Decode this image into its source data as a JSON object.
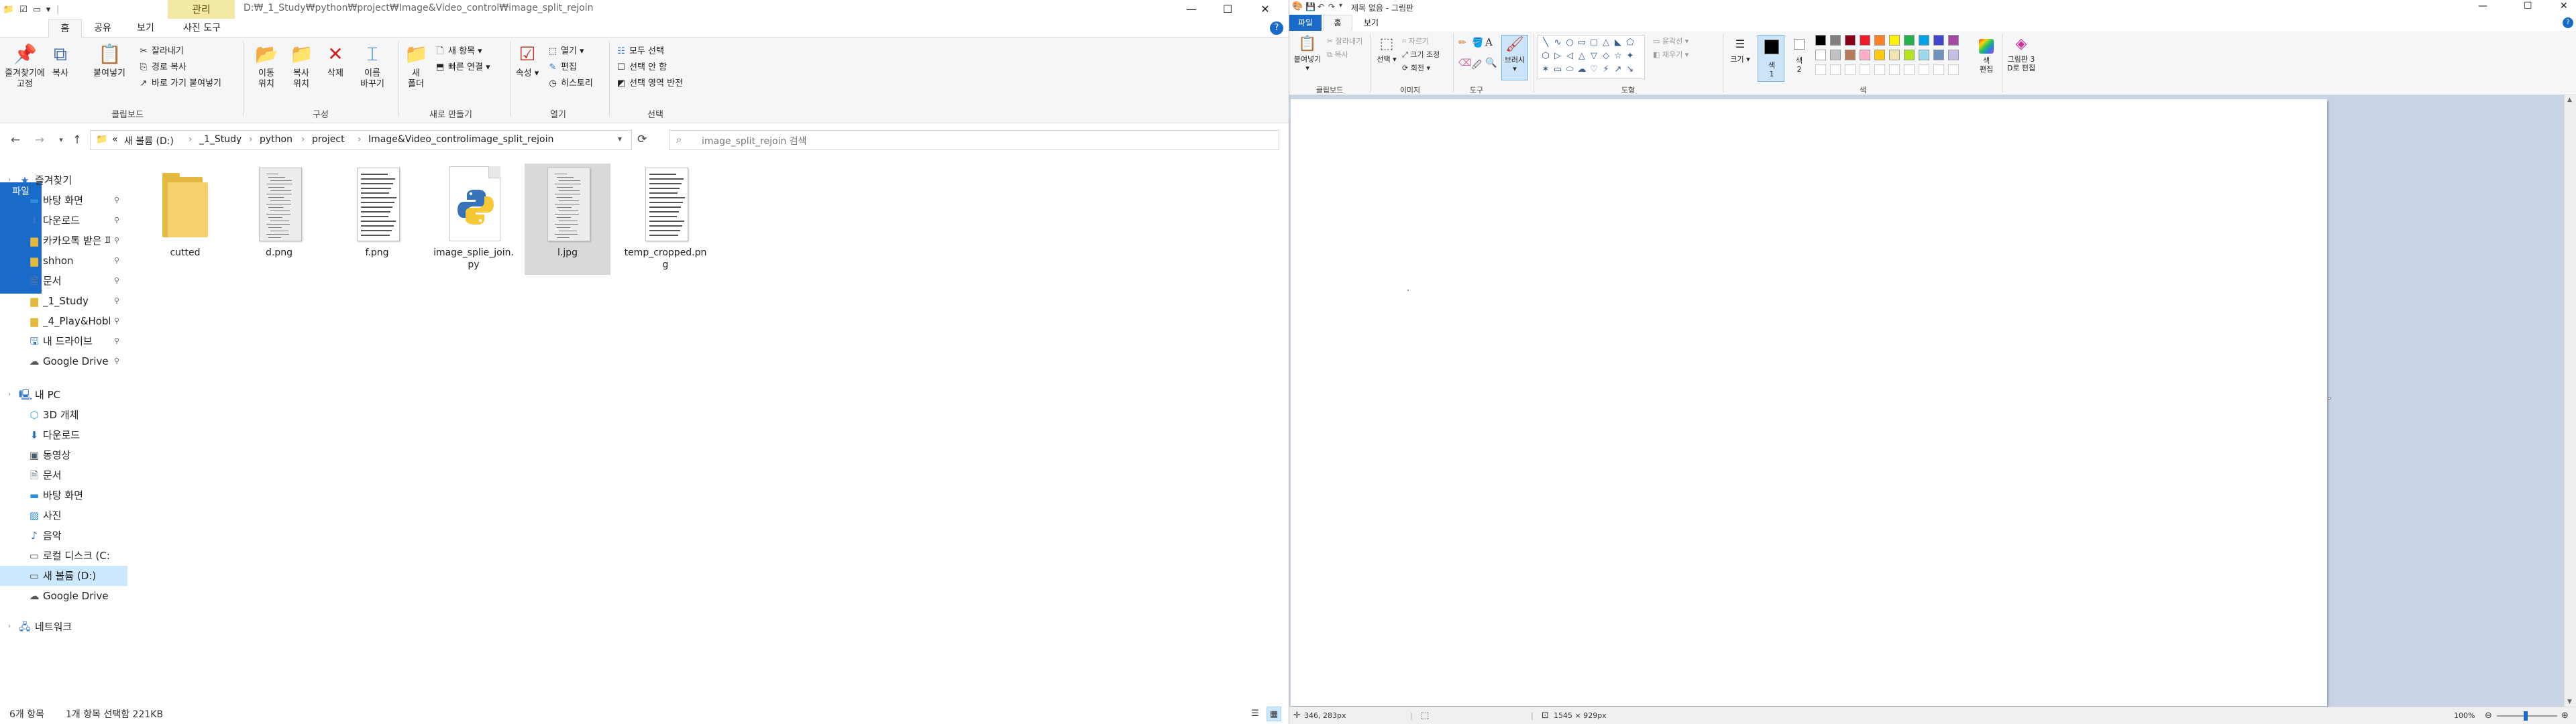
{
  "explorer": {
    "manage_tab": "관리",
    "title_path": "D:₩_1_Study₩python₩project₩Image&Video_control₩image_split_rejoin",
    "tabs": [
      "파일",
      "홈",
      "공유",
      "보기",
      "사진 도구"
    ],
    "window_buttons": [
      "—",
      "☐",
      "✕"
    ],
    "help": "?",
    "ribbon": {
      "pin_quick": "즐겨찾기에\n고정",
      "copy": "복사",
      "paste": "붙여넣기",
      "cut": "잘라내기",
      "copy_path": "경로 복사",
      "paste_shortcut": "바로 가기 붙여넣기",
      "move_to": "이동\n위치",
      "copy_to": "복사\n위치",
      "delete": "삭제",
      "rename": "이름\n바꾸기",
      "new_folder": "새\n폴더",
      "new_item": "새 항목",
      "easy_access": "빠른 연결",
      "properties": "속성",
      "open": "열기",
      "edit": "편집",
      "history": "히스토리",
      "select_all": "모두 선택",
      "select_none": "선택 안 함",
      "invert_selection": "선택 영역 반전",
      "groups": [
        "클립보드",
        "구성",
        "새로 만들기",
        "열기",
        "선택"
      ]
    },
    "address": {
      "crumbs": [
        "새 볼륨 (D:)",
        "_1_Study",
        "python",
        "project",
        "Image&Video_control",
        "image_split_rejoin"
      ],
      "prefix": "«"
    },
    "search_placeholder": "image_split_rejoin 검색",
    "nav": [
      {
        "label": "즐겨찾기",
        "icon": "star-icon",
        "pinned": false,
        "level": 0
      },
      {
        "label": "바탕 화면",
        "icon": "desktop-icon",
        "pinned": true,
        "level": 1
      },
      {
        "label": "다운로드",
        "icon": "download-icon",
        "pinned": true,
        "level": 1
      },
      {
        "label": "카카오톡 받은 파",
        "icon": "folder-icon",
        "pinned": true,
        "level": 1
      },
      {
        "label": "shhon",
        "icon": "folder-icon",
        "pinned": true,
        "level": 1
      },
      {
        "label": "문서",
        "icon": "document-icon",
        "pinned": true,
        "level": 1
      },
      {
        "label": "_1_Study",
        "icon": "folder-icon",
        "pinned": true,
        "level": 1
      },
      {
        "label": "_4_Play&Hobby",
        "icon": "folder-icon",
        "pinned": true,
        "level": 1
      },
      {
        "label": "내 드라이브",
        "icon": "drive-icon",
        "pinned": true,
        "level": 1
      },
      {
        "label": "Google Drive (G",
        "icon": "cloud-drive-icon",
        "pinned": true,
        "level": 1
      },
      {
        "label": "내 PC",
        "icon": "pc-icon",
        "pinned": false,
        "level": 0
      },
      {
        "label": "3D 개체",
        "icon": "3d-objects-icon",
        "pinned": false,
        "level": 1
      },
      {
        "label": "다운로드",
        "icon": "download-icon",
        "pinned": false,
        "level": 1
      },
      {
        "label": "동영상",
        "icon": "video-icon",
        "pinned": false,
        "level": 1
      },
      {
        "label": "문서",
        "icon": "document-icon",
        "pinned": false,
        "level": 1
      },
      {
        "label": "바탕 화면",
        "icon": "desktop-icon",
        "pinned": false,
        "level": 1
      },
      {
        "label": "사진",
        "icon": "pictures-icon",
        "pinned": false,
        "level": 1
      },
      {
        "label": "음악",
        "icon": "music-icon",
        "pinned": false,
        "level": 1
      },
      {
        "label": "로컬 디스크 (C:)",
        "icon": "disk-icon",
        "pinned": false,
        "level": 1
      },
      {
        "label": "새 볼륨 (D:)",
        "icon": "disk-icon",
        "pinned": false,
        "level": 1,
        "active": true
      },
      {
        "label": "Google Drive (G:)",
        "icon": "cloud-drive-icon",
        "pinned": false,
        "level": 1
      },
      {
        "label": "네트워크",
        "icon": "network-icon",
        "pinned": false,
        "level": 0
      }
    ],
    "files": [
      {
        "name": "cutted",
        "type": "folder"
      },
      {
        "name": "d.png",
        "type": "scan"
      },
      {
        "name": "f.png",
        "type": "text-doc"
      },
      {
        "name": "image_splie_join.py",
        "type": "python"
      },
      {
        "name": "l.jpg",
        "type": "scan",
        "selected": true
      },
      {
        "name": "temp_cropped.png",
        "type": "text-doc"
      }
    ],
    "status": {
      "count": "6개 항목",
      "selection": "1개 항목 선택함 221KB"
    }
  },
  "paint": {
    "title": "제목 없음 - 그림판",
    "tabs": [
      "파일",
      "홈",
      "보기"
    ],
    "window_buttons": [
      "—",
      "☐",
      "✕"
    ],
    "ribbon": {
      "paste": "붙여넣기",
      "cut": "잘라내기",
      "copy": "복사",
      "select": "선택",
      "crop": "자르기",
      "resize": "크기 조정",
      "rotate": "회전",
      "brushes": "브러시",
      "outline": "윤곽선",
      "fill": "채우기",
      "size": "크기",
      "color1": "색\n1",
      "color2": "색\n2",
      "edit_colors": "색\n편집",
      "paint3d": "그림판 3\nD로 편집",
      "groups": [
        "클립보드",
        "이미지",
        "도구",
        "도형",
        "색"
      ]
    },
    "palette": [
      "#000000",
      "#7f7f7f",
      "#880015",
      "#ed1c24",
      "#ff7f27",
      "#fff200",
      "#22b14c",
      "#00a2e8",
      "#3f48cc",
      "#a349a4",
      "#ffffff",
      "#c3c3c3",
      "#b97a57",
      "#ffaec9",
      "#ffc90e",
      "#efe4b0",
      "#b5e61d",
      "#99d9ea",
      "#7092be",
      "#c8bfe7"
    ],
    "status": {
      "cursor": "346, 283px",
      "canvas_size": "1545 × 929px",
      "zoom": "100%"
    }
  }
}
